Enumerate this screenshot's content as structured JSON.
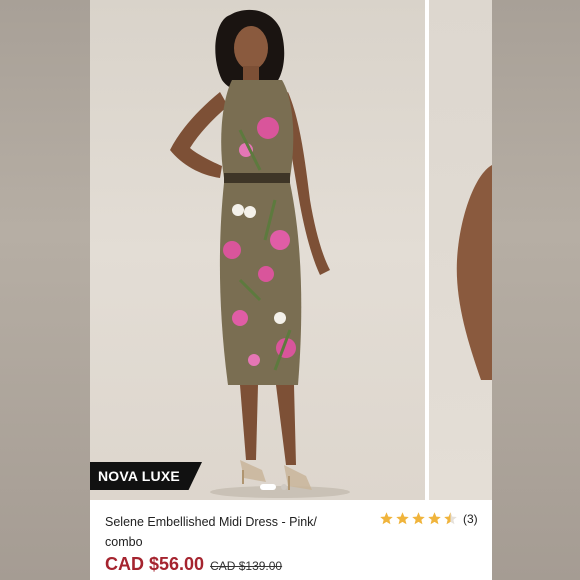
{
  "brand": {
    "name": "NOVA LUXE"
  },
  "carousel": {
    "slide_count": 2,
    "active_slide": 1
  },
  "product": {
    "title": "Selene Embellished Midi Dress - Pink/ combo",
    "rating_value": 4.5,
    "rating_max": 5,
    "review_count": "(3)",
    "sale_price": "CAD $56.00",
    "original_price": "CAD $139.00"
  },
  "colors": {
    "sale_price": "#a5242f",
    "star": "#f0b43c",
    "badge_bg": "#111111",
    "photo_bg": "#e0dad2"
  },
  "icons": {
    "rating_star": "star-icon"
  }
}
